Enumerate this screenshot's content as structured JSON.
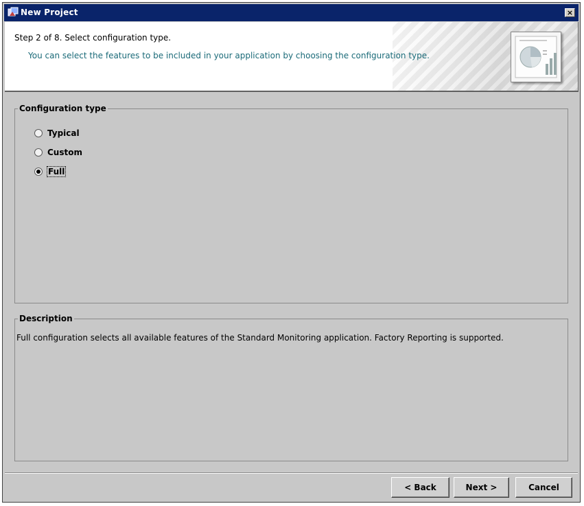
{
  "window": {
    "title": "New Project",
    "close_label": "×"
  },
  "header": {
    "step_title": "Step 2 of 8. Select configuration type.",
    "step_description": "You can select the features to be included in your application by choosing the configuration type."
  },
  "config": {
    "legend": "Configuration type",
    "options": [
      {
        "label": "Typical",
        "checked": false
      },
      {
        "label": "Custom",
        "checked": false
      },
      {
        "label": "Full",
        "checked": true
      }
    ]
  },
  "description": {
    "legend": "Description",
    "text": "Full configuration selects all available features of the Standard Monitoring application. Factory Reporting is supported."
  },
  "buttons": {
    "back": "< Back",
    "next": "Next >",
    "cancel": "Cancel"
  },
  "colors": {
    "titlebar": "#0a246a",
    "step_desc": "#1a6a78",
    "window_bg": "#c8c8c8"
  }
}
